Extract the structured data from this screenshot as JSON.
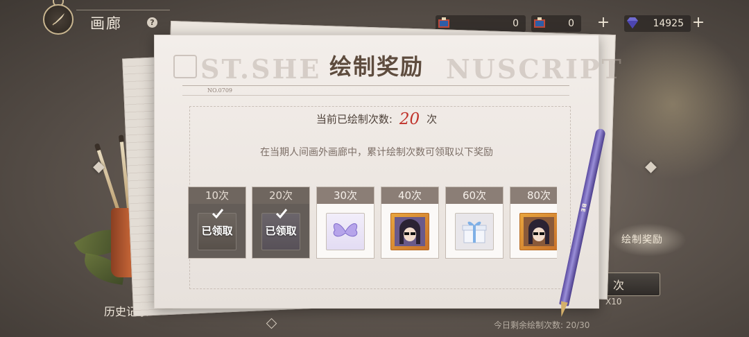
{
  "header": {
    "page_title": "画廊",
    "help_symbol": "?"
  },
  "currencies": [
    {
      "icon": "ticket-pass-icon",
      "value": "0"
    },
    {
      "icon": "ticket-pass-alt-icon",
      "value": "0"
    },
    {
      "icon": "diamond-gem-icon",
      "value": "14925"
    }
  ],
  "plus_symbol": "+",
  "modal": {
    "title": "绘制奖励",
    "background_text": "ST.SHE",
    "background_text_right": "NUSCRIPT",
    "doc_number": "NO.0709",
    "count_label": "当前已绘制次数:",
    "count_value": "20",
    "count_unit": "次",
    "description": "在当期人间画外画廊中，累计绘制次数可领取以下奖励"
  },
  "rewards": [
    {
      "label": "10次",
      "claimed": true,
      "item_icon": "artwork-item-icon"
    },
    {
      "label": "20次",
      "claimed": true,
      "item_icon": "artwork-item-icon"
    },
    {
      "label": "30次",
      "claimed": false,
      "item_icon": "butterfly-item-icon"
    },
    {
      "label": "40次",
      "claimed": false,
      "item_icon": "avatar-frame-icon"
    },
    {
      "label": "60次",
      "claimed": false,
      "item_icon": "gift-box-icon"
    },
    {
      "label": "80次",
      "claimed": false,
      "item_icon": "avatar-frame-icon"
    }
  ],
  "claimed_label": "已领取",
  "background": {
    "history_label": "历史记录",
    "draw_label": "绘制奖励",
    "times_label": "次",
    "x10_label": "X10",
    "remaining_label": "今日剩余绘制次数: 20/30"
  },
  "colors": {
    "accent_red": "#c0332b",
    "card_header": "#8b7e76",
    "title_brown": "#5e4c3e"
  }
}
